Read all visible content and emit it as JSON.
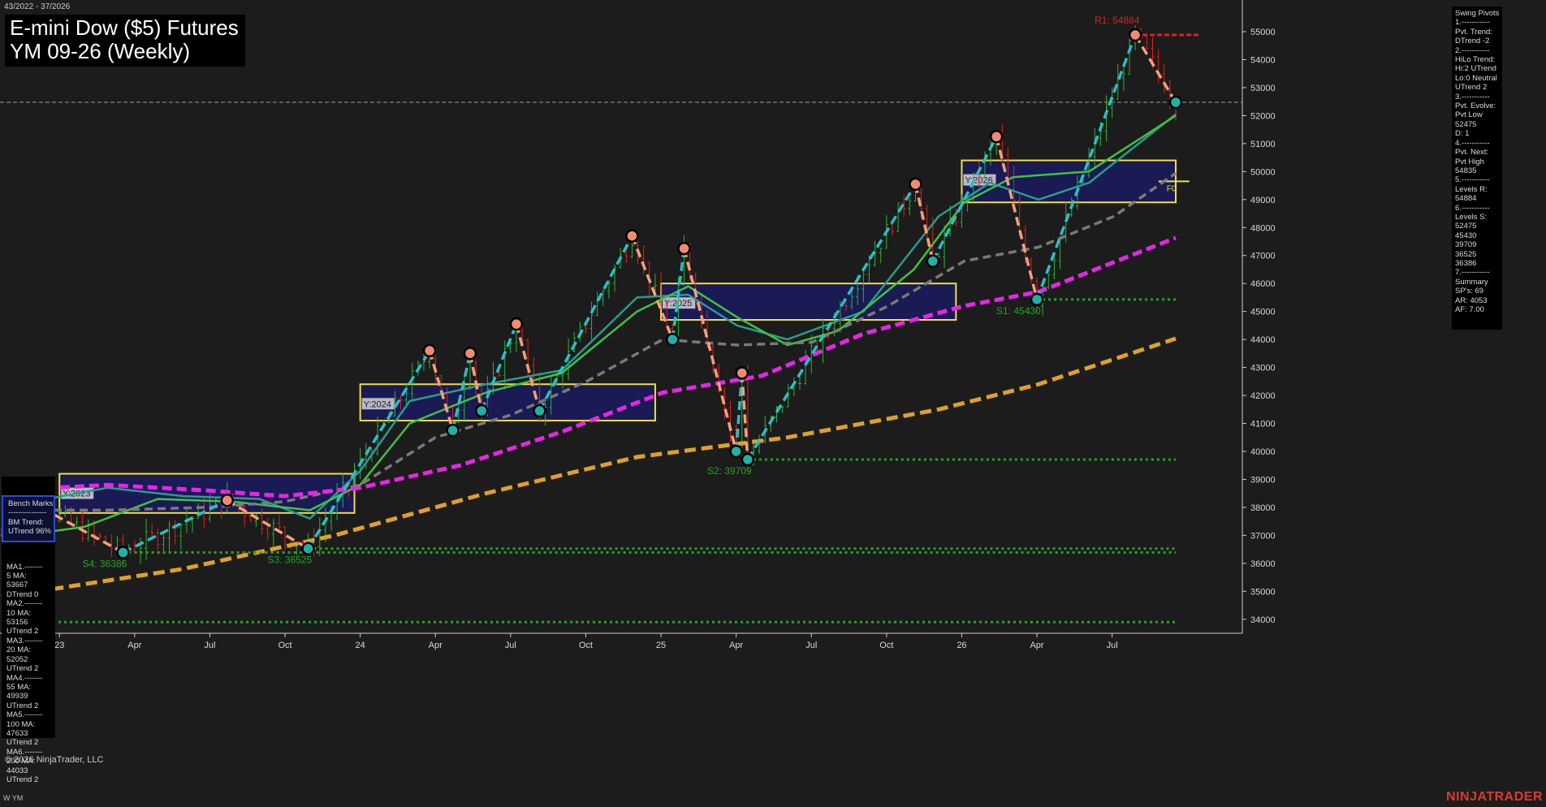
{
  "header": {
    "date_range": "43/2022 - 37/2026",
    "title_line1": "E-mini Dow ($5) Futures",
    "title_line2": "YM 09-26 (Weekly)",
    "instrument_small": "W YM",
    "copyright": "© 2026 NinjaTrader, LLC",
    "brand": "NINJATRADER"
  },
  "swing_panel": {
    "lines": [
      "Swing Pivots",
      "1.-----------",
      "Pvt. Trend:",
      "DTrend -2",
      "2.-----------",
      "HiLo Trend:",
      "Hi:2 UTrend",
      "Lo:0 Neutral",
      "UTrend 2",
      "3.-----------",
      "Pvt. Evolve:",
      "Pvt Low",
      "52475",
      "D: 1",
      "4.-----------",
      "Pvt. Next:",
      "Pvt High",
      "54835",
      "5.-----------",
      "Levels R:",
      "54884",
      "6.-----------",
      "Levels S:",
      "52475",
      "45430",
      "39709",
      "36525",
      "36386",
      "7.-----------",
      "Summary",
      "SP's: 69",
      "AR: 4053",
      "AF: 7.00"
    ]
  },
  "bench_panel": {
    "head": [
      "Bench Marks",
      "---------------",
      "BM Trend:",
      "UTrend 96%"
    ],
    "lines": [
      "MA1.-------",
      "5 MA:",
      "53667",
      "DTrend 0",
      "MA2.-------",
      "10 MA:",
      "53156",
      "UTrend 2",
      "MA3.-------",
      "20 MA:",
      "52052",
      "UTrend 2",
      "MA4.-------",
      "55 MA:",
      "49939",
      "UTrend 2",
      "MA5.-------",
      "100 MA:",
      "47633",
      "UTrend 2",
      "MA6.-------",
      "200 MA:",
      "44033",
      "UTrend 2"
    ]
  },
  "colors": {
    "background": "#1c1c1c",
    "bull_bar": "#2db52d",
    "bear_bar": "#e02020",
    "pivot_high_line": "#f4a07a",
    "pivot_low_line": "#2bbfc8",
    "ma_green": "#3ec43e",
    "ma_teal": "#2a9c8c",
    "ma_grey": "#7a7a7a",
    "ma_magenta": "#e626e6",
    "ma_orange": "#e0a028",
    "support": "#1fa81f",
    "resistance": "#e02020",
    "year_box_fill": "#1a1a5e",
    "year_box_border": "#f0e040"
  },
  "chart_data": {
    "type": "line",
    "title": "E-mini Dow ($5) Futures YM 09-26 (Weekly)",
    "y_axis_side": "right",
    "ylim": [
      33500,
      55900
    ],
    "y_ticks": [
      34000,
      35000,
      36000,
      37000,
      38000,
      39000,
      40000,
      41000,
      42000,
      43000,
      44000,
      45000,
      46000,
      47000,
      48000,
      49000,
      50000,
      51000,
      52000,
      53000,
      54000,
      55000
    ],
    "x_start": "2022-10-24",
    "x_end": "2026-09-14",
    "x_ticks": [
      {
        "label": "23",
        "date": "2023-01-02"
      },
      {
        "label": "Apr",
        "date": "2023-04-03"
      },
      {
        "label": "Jul",
        "date": "2023-07-03"
      },
      {
        "label": "Oct",
        "date": "2023-10-02"
      },
      {
        "label": "24",
        "date": "2024-01-01"
      },
      {
        "label": "Apr",
        "date": "2024-04-01"
      },
      {
        "label": "Jul",
        "date": "2024-07-01"
      },
      {
        "label": "Oct",
        "date": "2024-09-30"
      },
      {
        "label": "25",
        "date": "2024-12-30"
      },
      {
        "label": "Apr",
        "date": "2025-03-31"
      },
      {
        "label": "Jul",
        "date": "2025-06-30"
      },
      {
        "label": "Oct",
        "date": "2025-09-29"
      },
      {
        "label": "26",
        "date": "2025-12-29"
      },
      {
        "label": "Apr",
        "date": "2026-03-30"
      },
      {
        "label": "Jul",
        "date": "2026-06-29"
      }
    ],
    "current_price": 52475,
    "swing_pivots": [
      {
        "date": "2022-11-28",
        "price": 38200,
        "type": "high"
      },
      {
        "date": "2023-03-20",
        "price": 36386,
        "type": "low"
      },
      {
        "date": "2023-07-24",
        "price": 38250,
        "type": "high"
      },
      {
        "date": "2023-10-30",
        "price": 36525,
        "type": "low"
      },
      {
        "date": "2024-03-25",
        "price": 43600,
        "type": "high"
      },
      {
        "date": "2024-04-22",
        "price": 40750,
        "type": "low"
      },
      {
        "date": "2024-05-13",
        "price": 43500,
        "type": "high"
      },
      {
        "date": "2024-05-27",
        "price": 41450,
        "type": "low"
      },
      {
        "date": "2024-07-08",
        "price": 44550,
        "type": "high"
      },
      {
        "date": "2024-08-05",
        "price": 41450,
        "type": "low"
      },
      {
        "date": "2024-11-25",
        "price": 47700,
        "type": "high"
      },
      {
        "date": "2025-01-13",
        "price": 44000,
        "type": "low"
      },
      {
        "date": "2025-01-27",
        "price": 47250,
        "type": "high"
      },
      {
        "date": "2025-03-31",
        "price": 40000,
        "type": "low"
      },
      {
        "date": "2025-04-07",
        "price": 42800,
        "type": "high"
      },
      {
        "date": "2025-04-14",
        "price": 39709,
        "type": "low"
      },
      {
        "date": "2025-11-03",
        "price": 49550,
        "type": "high"
      },
      {
        "date": "2025-11-24",
        "price": 46800,
        "type": "low"
      },
      {
        "date": "2026-02-09",
        "price": 51250,
        "type": "high"
      },
      {
        "date": "2026-03-30",
        "price": 45430,
        "type": "low"
      },
      {
        "date": "2026-07-27",
        "price": 54884,
        "type": "high"
      },
      {
        "date": "2026-09-14",
        "price": 52475,
        "type": "low"
      }
    ],
    "support_levels": [
      {
        "label": "S1: 45430",
        "value": 45430,
        "from": "2026-03-30"
      },
      {
        "label": "S2: 39709",
        "value": 39709,
        "from": "2025-04-14"
      },
      {
        "label": "S3: 36525",
        "value": 36525,
        "from": "2023-10-30"
      },
      {
        "label": "S4: 36386",
        "value": 36386,
        "from": "2023-03-20"
      },
      {
        "label": "",
        "value": 33900,
        "from": "2022-10-24"
      }
    ],
    "resistance_levels": [
      {
        "label": "R1: 54884",
        "value": 54884,
        "from": "2026-07-27"
      }
    ],
    "year_boxes": [
      {
        "label": "Y:2023",
        "from": "2023-01-02",
        "to": "2023-12-25",
        "low": 37800,
        "high": 39200
      },
      {
        "label": "Y:2024",
        "from": "2024-01-01",
        "to": "2024-12-23",
        "low": 41100,
        "high": 42400
      },
      {
        "label": "Y:2025",
        "from": "2024-12-30",
        "to": "2025-12-22",
        "low": 44700,
        "high": 46000
      },
      {
        "label": "Y:2026",
        "from": "2025-12-29",
        "to": "2026-09-14",
        "low": 48900,
        "high": 50400
      }
    ],
    "f0_label": "F0",
    "f0_value": 49650,
    "moving_averages": [
      {
        "name": "5 MA",
        "color": "#2a9c8c",
        "values": [
          [
            "2022-10-24",
            38000
          ],
          [
            "2023-03-01",
            38700
          ],
          [
            "2023-06-01",
            38400
          ],
          [
            "2023-09-01",
            38300
          ],
          [
            "2023-11-01",
            37600
          ],
          [
            "2024-01-01",
            39300
          ],
          [
            "2024-03-01",
            41800
          ],
          [
            "2024-06-01",
            42400
          ],
          [
            "2024-09-01",
            42900
          ],
          [
            "2024-12-01",
            45500
          ],
          [
            "2025-02-01",
            45600
          ],
          [
            "2025-04-01",
            44500
          ],
          [
            "2025-06-01",
            44000
          ],
          [
            "2025-09-01",
            45000
          ],
          [
            "2025-12-01",
            48400
          ],
          [
            "2026-02-01",
            49600
          ],
          [
            "2026-04-01",
            49000
          ],
          [
            "2026-06-01",
            49600
          ],
          [
            "2026-09-14",
            52050
          ]
        ]
      },
      {
        "name": "20 MA",
        "color": "#3ec43e",
        "values": [
          [
            "2022-10-24",
            36900
          ],
          [
            "2023-02-01",
            37300
          ],
          [
            "2023-05-01",
            38300
          ],
          [
            "2023-08-01",
            38200
          ],
          [
            "2023-11-01",
            37900
          ],
          [
            "2024-01-01",
            38800
          ],
          [
            "2024-03-01",
            41000
          ],
          [
            "2024-06-01",
            42100
          ],
          [
            "2024-09-01",
            42800
          ],
          [
            "2024-12-01",
            45000
          ],
          [
            "2025-02-01",
            45900
          ],
          [
            "2025-04-01",
            44800
          ],
          [
            "2025-06-01",
            43800
          ],
          [
            "2025-08-01",
            44300
          ],
          [
            "2025-11-01",
            46500
          ],
          [
            "2026-01-01",
            48900
          ],
          [
            "2026-03-01",
            49800
          ],
          [
            "2026-06-01",
            50000
          ],
          [
            "2026-09-14",
            52000
          ]
        ]
      },
      {
        "name": "55 MA",
        "color": "#7a7a7a",
        "values": [
          [
            "2022-10-24",
            37900
          ],
          [
            "2023-03-01",
            37900
          ],
          [
            "2023-07-01",
            38000
          ],
          [
            "2023-10-01",
            38200
          ],
          [
            "2024-01-01",
            38800
          ],
          [
            "2024-04-01",
            40500
          ],
          [
            "2024-07-01",
            41300
          ],
          [
            "2024-10-01",
            42500
          ],
          [
            "2025-01-01",
            44000
          ],
          [
            "2025-04-01",
            43800
          ],
          [
            "2025-07-01",
            43900
          ],
          [
            "2025-10-01",
            45200
          ],
          [
            "2026-01-01",
            46800
          ],
          [
            "2026-04-01",
            47300
          ],
          [
            "2026-07-01",
            48400
          ],
          [
            "2026-09-14",
            49939
          ]
        ]
      },
      {
        "name": "100 MA",
        "color": "#e626e6",
        "values": [
          [
            "2022-10-24",
            38600
          ],
          [
            "2023-03-01",
            38800
          ],
          [
            "2023-07-01",
            38600
          ],
          [
            "2023-10-01",
            38400
          ],
          [
            "2024-01-01",
            38700
          ],
          [
            "2024-05-01",
            39500
          ],
          [
            "2024-09-01",
            40700
          ],
          [
            "2025-01-01",
            42100
          ],
          [
            "2025-05-01",
            42700
          ],
          [
            "2025-09-01",
            44200
          ],
          [
            "2026-01-01",
            45200
          ],
          [
            "2026-04-01",
            45700
          ],
          [
            "2026-09-14",
            47633
          ]
        ]
      },
      {
        "name": "200 MA",
        "color": "#e0a028",
        "values": [
          [
            "2022-10-24",
            34800
          ],
          [
            "2023-06-01",
            35800
          ],
          [
            "2023-12-01",
            37000
          ],
          [
            "2024-06-01",
            38500
          ],
          [
            "2024-12-01",
            39800
          ],
          [
            "2025-06-01",
            40500
          ],
          [
            "2025-12-01",
            41500
          ],
          [
            "2026-04-01",
            42400
          ],
          [
            "2026-09-14",
            44033
          ]
        ]
      }
    ]
  }
}
